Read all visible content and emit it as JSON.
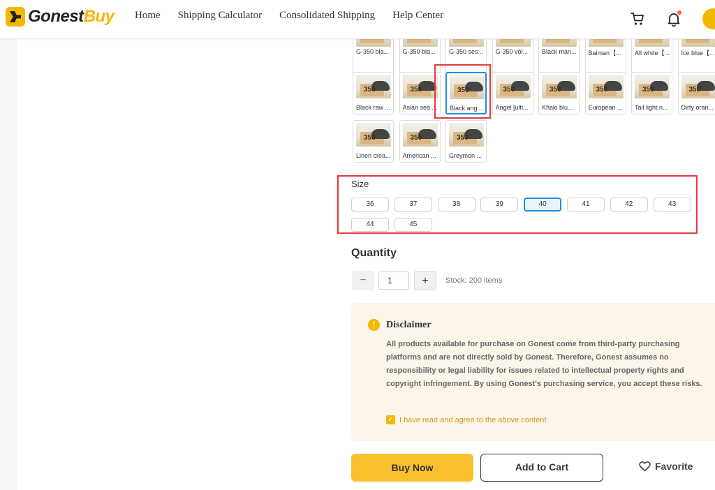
{
  "header": {
    "logo": {
      "text_dark": "Gonest",
      "text_accent": "Buy"
    },
    "nav": [
      "Home",
      "Shipping Calculator",
      "Consolidated Shipping",
      "Help Center"
    ],
    "icons": [
      "cart-icon",
      "bell-icon"
    ]
  },
  "variants": {
    "row1": [
      "G-350 bla...",
      "G-350 bla...",
      "G-350 ses...",
      "G-350 vol...",
      "Black man...",
      "Baiman【...",
      "All white【...",
      "Ice blue【..."
    ],
    "row2": [
      "Black raw ...",
      "Asian sea ...",
      "Black ang...",
      "Angel [ulti...",
      "Khaki blu...",
      "European ...",
      "Tail light n...",
      "Dirty oran..."
    ],
    "row3": [
      "Linen crea...",
      "American ...",
      "Greymon ..."
    ],
    "selected": "Black ang...",
    "thumb_label": "350"
  },
  "size": {
    "label": "Size",
    "options": [
      "36",
      "37",
      "38",
      "39",
      "40",
      "41",
      "42",
      "43",
      "44",
      "45"
    ],
    "selected": "40"
  },
  "quantity": {
    "label": "Quantity",
    "minus": "−",
    "plus": "+",
    "value": "1",
    "stock": "Stock: 200 items"
  },
  "disclaimer": {
    "icon": "!",
    "title": "Disclaimer",
    "body": "All products available for purchase on Gonest come from third-party purchasing platforms and are not directly sold by Gonest. Therefore, Gonest assumes no responsibility or legal liability for issues related to intellectual property rights and copyright infringement. By using Gonest's purchasing service, you accept these risks.",
    "agree_label": "I have read and agree to the above content",
    "agree_checked": true
  },
  "actions": {
    "buy_now": "Buy Now",
    "add_to_cart": "Add to Cart",
    "favorite": "Favorite"
  },
  "colors": {
    "brand": "#f5b800",
    "highlight": "#e33a3a",
    "selected": "#1d8fe0"
  }
}
